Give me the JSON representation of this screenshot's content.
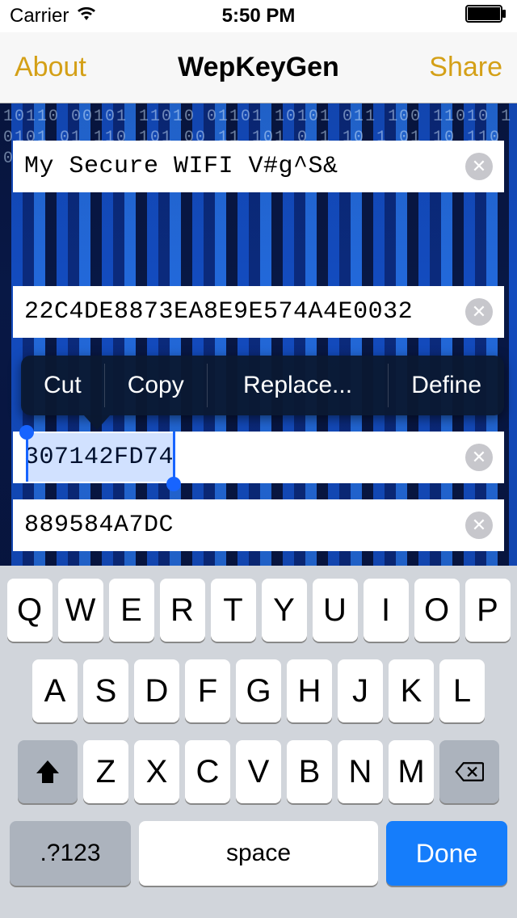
{
  "status": {
    "carrier": "Carrier",
    "time": "5:50 PM"
  },
  "nav": {
    "left": "About",
    "title": "WepKeyGen",
    "right": "Share"
  },
  "fields": {
    "passphrase": "My Secure WIFI V#g^S&",
    "key128": "22C4DE8873EA8E9E574A4E0032",
    "key64a": "307142FD74",
    "key64b": "889584A7DC"
  },
  "context_menu": {
    "cut": "Cut",
    "copy": "Copy",
    "replace": "Replace...",
    "define": "Define"
  },
  "keyboard": {
    "row1": [
      "Q",
      "W",
      "E",
      "R",
      "T",
      "Y",
      "U",
      "I",
      "O",
      "P"
    ],
    "row2": [
      "A",
      "S",
      "D",
      "F",
      "G",
      "H",
      "J",
      "K",
      "L"
    ],
    "row3": [
      "Z",
      "X",
      "C",
      "V",
      "B",
      "N",
      "M"
    ],
    "numkey": ".?123",
    "space": "space",
    "done": "Done"
  }
}
